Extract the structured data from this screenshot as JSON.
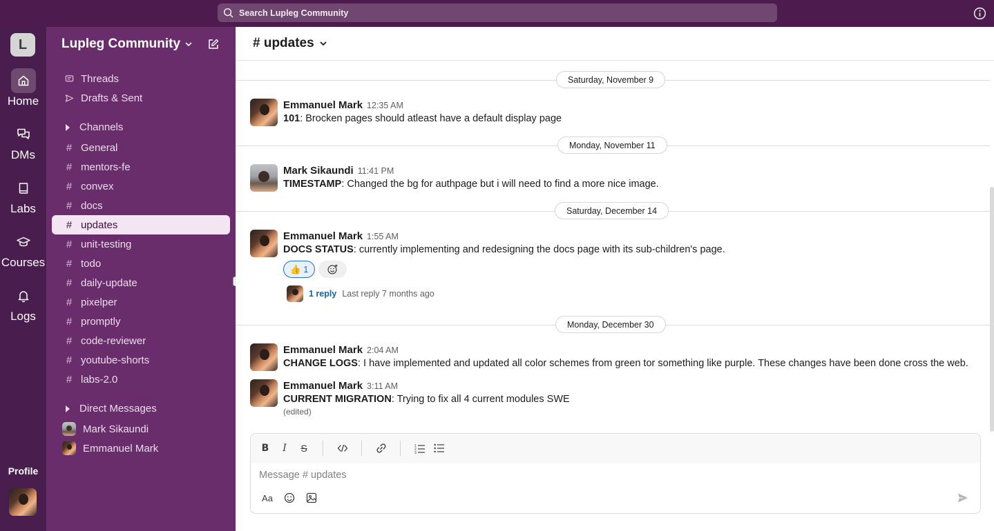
{
  "topbar": {
    "search_placeholder": "Search Lupleg Community"
  },
  "rail": {
    "workspace_initial": "L",
    "items": [
      {
        "label": "Home",
        "icon": "home-icon"
      },
      {
        "label": "DMs",
        "icon": "dms-icon"
      },
      {
        "label": "Labs",
        "icon": "book-icon"
      },
      {
        "label": "Courses",
        "icon": "graduation-cap-icon"
      },
      {
        "label": "Logs",
        "icon": "bell-icon"
      }
    ],
    "profile_label": "Profile"
  },
  "sidebar": {
    "workspace_name": "Lupleg Community",
    "top_items": [
      {
        "label": "Threads",
        "icon": "threads-icon"
      },
      {
        "label": "Drafts & Sent",
        "icon": "send-icon"
      }
    ],
    "channels_header": "Channels",
    "channels": [
      "General",
      "mentors-fe",
      "convex",
      "docs",
      "updates",
      "unit-testing",
      "todo",
      "daily-update",
      "pixelper",
      "promptly",
      "code-reviewer",
      "youtube-shorts",
      "labs-2.0"
    ],
    "active_channel": "updates",
    "dm_header": "Direct Messages",
    "dms": [
      "Mark Sikaundi",
      "Emmanuel Mark"
    ]
  },
  "channel": {
    "title": "# updates"
  },
  "dates": [
    "Saturday, November 9",
    "Monday, November 11",
    "Saturday, December 14",
    "Monday, December 30"
  ],
  "messages": [
    {
      "author": "Emmanuel Mark",
      "time": "12:35 AM",
      "tag": "101",
      "text": ": Brocken pages should atleast have a default display page"
    },
    {
      "author": "Mark Sikaundi",
      "time": "11:41 PM",
      "tag": "TIMESTAMP",
      "text": ": Changed the bg for authpage but i will need to find a more nice image."
    },
    {
      "author": "Emmanuel Mark",
      "time": "1:55 AM",
      "tag": "DOCS STATUS",
      "text": ": currently implementing and redesigning the docs page with its sub-children's page."
    },
    {
      "author": "Emmanuel Mark",
      "time": "2:04 AM",
      "tag": "CHANGE LOGS",
      "text": ": I have implemented and updated all color schemes from green tor something like purple. These changes have been done cross the web."
    },
    {
      "author": "Emmanuel Mark",
      "time": "3:11 AM",
      "tag": "CURRENT MIGRATION",
      "text": ": Trying to fix all 4 current modules SWE",
      "edited": "(edited)"
    }
  ],
  "reaction": {
    "emoji": "👍",
    "count": "1"
  },
  "thread": {
    "replies": "1 reply",
    "last_reply": "Last reply 7 months ago"
  },
  "composer": {
    "placeholder": "Message # updates"
  }
}
